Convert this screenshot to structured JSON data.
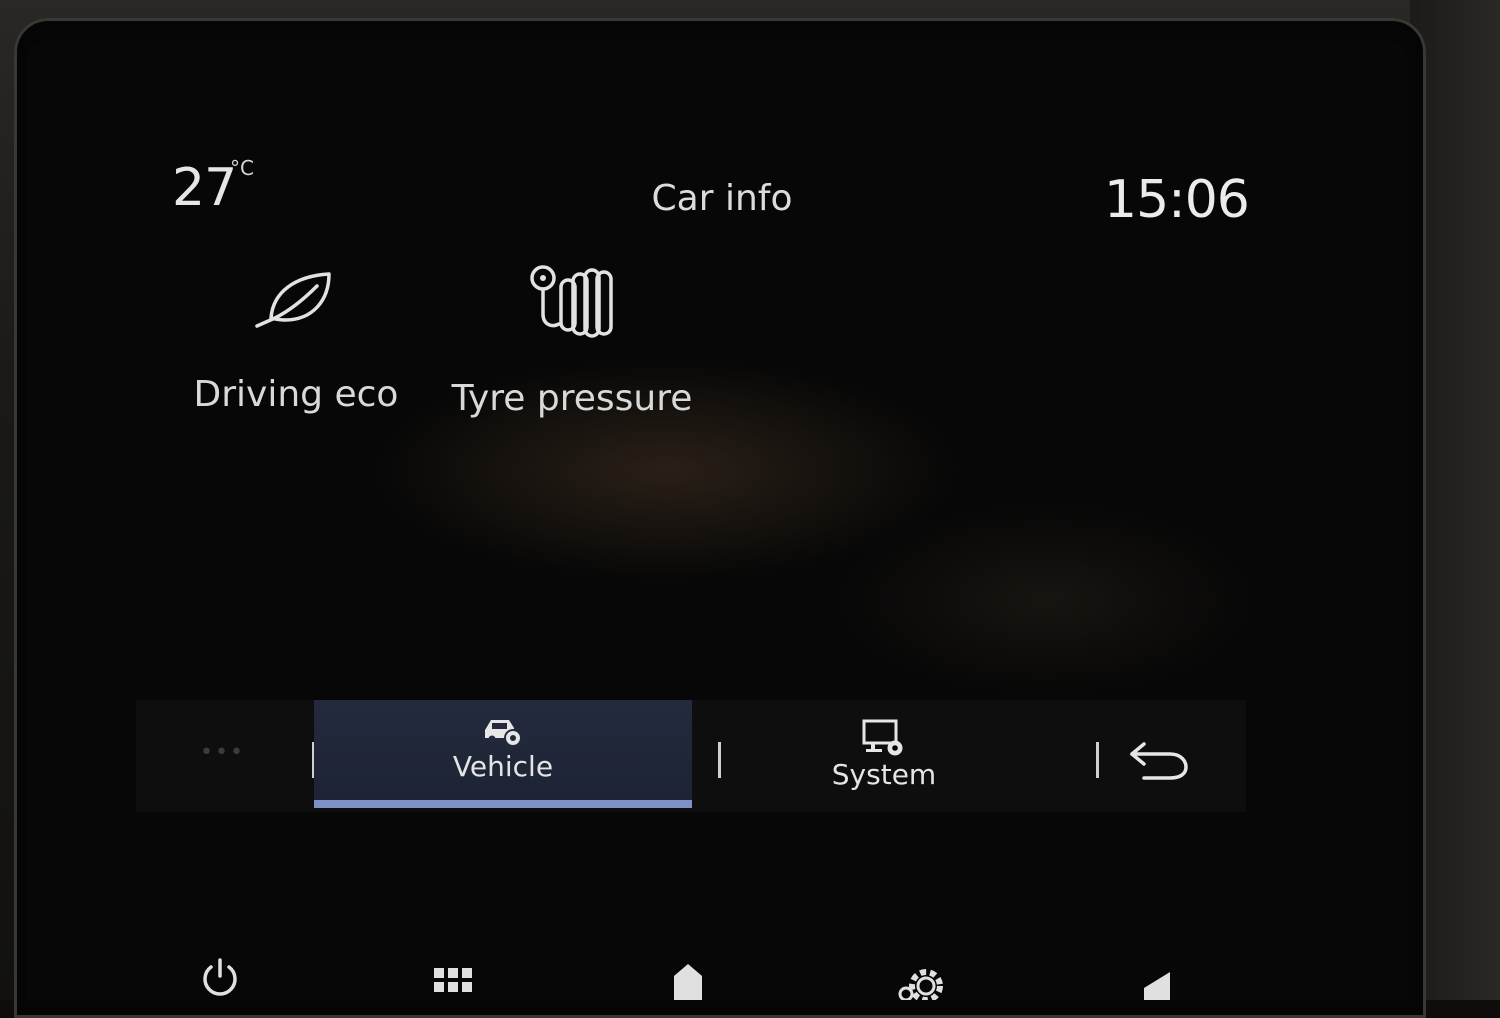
{
  "status": {
    "temperature": "27",
    "temperature_unit": "°C",
    "title": "Car info",
    "clock": "15:06"
  },
  "tiles": [
    {
      "label": "Driving eco",
      "icon": "leaf-icon"
    },
    {
      "label": "Tyre pressure",
      "icon": "tyre-pressure-icon"
    }
  ],
  "tabbar": {
    "more": "•••",
    "tabs": [
      {
        "label": "Vehicle",
        "icon": "car-settings-icon",
        "selected": true
      },
      {
        "label": "System",
        "icon": "screen-settings-icon",
        "selected": false
      }
    ],
    "back_icon": "back-arrow-icon"
  },
  "hardware_buttons": [
    "power-icon",
    "apps-grid-icon",
    "home-icon",
    "settings-gear-icon",
    "volume-icon"
  ],
  "colors": {
    "selected_tab_bg": "#232a3d",
    "selected_tab_underline": "#7f8fc7",
    "text": "#dcdcdc"
  }
}
